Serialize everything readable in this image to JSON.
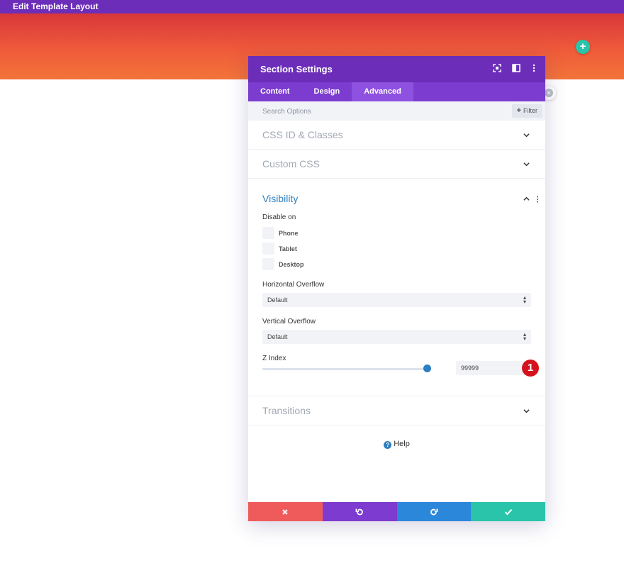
{
  "topbar": {
    "title": "Edit Template Layout"
  },
  "modal": {
    "title": "Section Settings",
    "tabs": [
      {
        "label": "Content"
      },
      {
        "label": "Design"
      },
      {
        "label": "Advanced"
      }
    ],
    "search": {
      "placeholder": "Search Options",
      "filter_label": "Filter"
    },
    "sections": {
      "css_id": "CSS ID & Classes",
      "custom_css": "Custom CSS",
      "visibility": "Visibility",
      "transitions": "Transitions"
    },
    "visibility": {
      "disable_on_label": "Disable on",
      "checkboxes": [
        {
          "label": "Phone"
        },
        {
          "label": "Tablet"
        },
        {
          "label": "Desktop"
        }
      ],
      "horizontal_overflow": {
        "label": "Horizontal Overflow",
        "value": "Default"
      },
      "vertical_overflow": {
        "label": "Vertical Overflow",
        "value": "Default"
      },
      "z_index": {
        "label": "Z Index",
        "value": "99999",
        "slider_fraction": 1.0
      },
      "badge": "1"
    },
    "help_label": "Help"
  },
  "colors": {
    "header_purple": "#6c2eb9",
    "tab_purple": "#7b3ccf",
    "active_tab": "#8f51e0",
    "accent_blue": "#2d7fc0",
    "cancel_red": "#ef5b5b",
    "undo_purple": "#7e3bd0",
    "redo_blue": "#2b87da",
    "save_green": "#29c4a9"
  }
}
